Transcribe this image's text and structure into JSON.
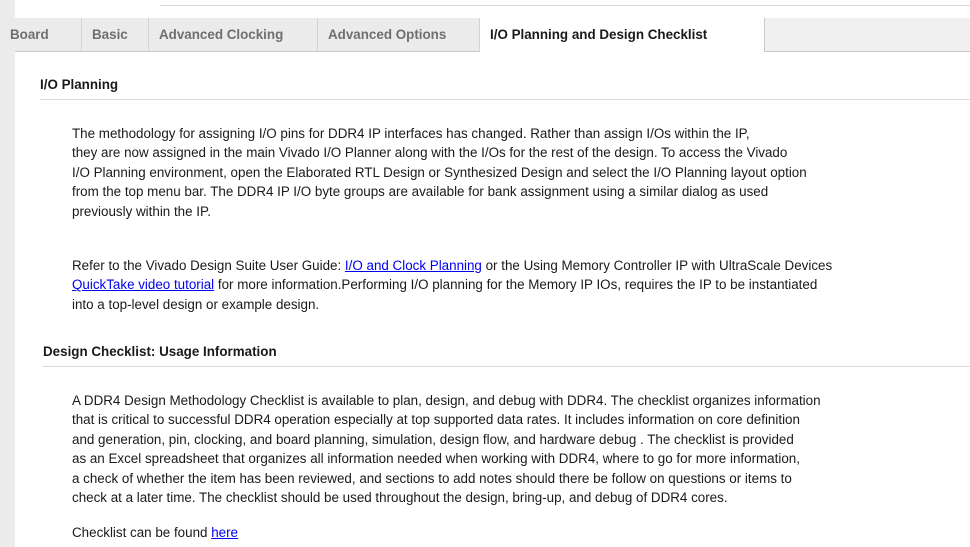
{
  "tabs": [
    {
      "label": "Board"
    },
    {
      "label": "Basic"
    },
    {
      "label": "Advanced Clocking"
    },
    {
      "label": "Advanced Options"
    },
    {
      "label": "I/O Planning and Design Checklist"
    }
  ],
  "io_planning": {
    "heading": "I/O Planning",
    "para1": [
      "The methodology for assigning I/O pins for DDR4 IP interfaces has changed. Rather than assign I/Os within the IP,",
      "they are now assigned in the main Vivado I/O Planner along with the I/Os for the rest of the design. To access the Vivado",
      "I/O Planning environment, open the Elaborated RTL Design or Synthesized Design and select the I/O Planning layout option",
      "from the top menu bar. The DDR4 IP I/O byte groups are available for bank assignment using a similar dialog as used",
      "previously within the IP."
    ],
    "para2": {
      "line1_prefix": "Refer to the Vivado Design Suite User Guide: ",
      "link1": "I/O and Clock Planning",
      "line1_suffix": " or the Using Memory Controller IP with UltraScale Devices",
      "link2": "QuickTake video tutorial",
      "line2_suffix": " for more information.Performing I/O planning for the Memory IP IOs, requires the IP to be instantiated",
      "line3": "into a top-level design or example design."
    }
  },
  "checklist": {
    "heading": "Design Checklist: Usage Information",
    "para": [
      "A DDR4 Design Methodology Checklist is available to plan, design, and debug with DDR4. The checklist organizes information",
      "that is critical to successful DDR4 operation especially at top supported data rates. It includes information on core definition",
      "and generation, pin, clocking, and board planning, simulation, design flow, and hardware debug . The checklist is provided",
      "as an Excel spreadsheet that organizes all information needed when working with DDR4, where to go for more information,",
      "a check of whether the item has been reviewed, and sections to add notes should there be follow on questions or items to",
      "check at a later time. The checklist should be used throughout the design, bring-up, and debug of DDR4 cores."
    ],
    "found_prefix": "Checklist can be found ",
    "found_link": "here"
  }
}
